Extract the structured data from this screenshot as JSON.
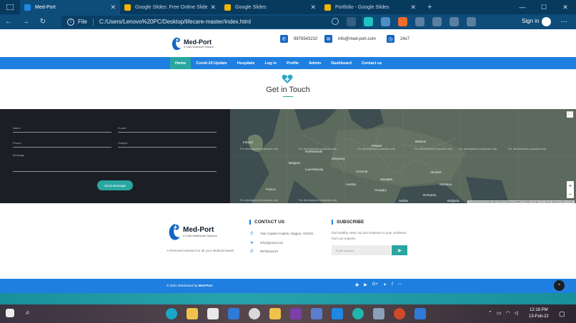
{
  "browser": {
    "tabs": [
      {
        "title": "Med-Port",
        "active": true,
        "color": "#1e88e5"
      },
      {
        "title": "Google Slides: Free Online Slide",
        "active": false,
        "color": "#f4b400"
      },
      {
        "title": "Google Slides",
        "active": false,
        "color": "#f4b400"
      },
      {
        "title": "Portfolio - Google Slides",
        "active": false,
        "color": "#f4b400"
      }
    ],
    "file_label": "File",
    "url": "C:/Users/Lenovo%20PC/Desktop/lifecare-master/index.html",
    "sign_in": "Sign in",
    "new_tab": "+"
  },
  "header": {
    "brand": "Med-Port",
    "tagline": "A Total Healthcare Solution",
    "phone": "9876543210",
    "email": "info@med-port.com",
    "hours": "24x7"
  },
  "nav": {
    "items": [
      "Home",
      "Covid-19 Update",
      "Hospitals",
      "Log in",
      "Profile",
      "Admin",
      "Dashboard",
      "Contact us"
    ],
    "active": "Home"
  },
  "contact": {
    "title": "Get in Touch",
    "form": {
      "name_placeholder": "Name",
      "email_placeholder": "E-mail",
      "phone_placeholder": "Phone",
      "subject_placeholder": "Subject",
      "message_placeholder": "Message",
      "send_label": "Send Message"
    }
  },
  "map": {
    "labels": [
      "Ireland",
      "Netherlands",
      "Poland",
      "Belarus",
      "Germany",
      "Belgium",
      "Luxembourg",
      "Czechia",
      "Ukraine",
      "Slovakia",
      "Austria",
      "Hungary",
      "Moldova",
      "Romania",
      "France",
      "Serbia",
      "Bulgaria"
    ],
    "watermark": "For development purposes only",
    "attribution": "Keyboard shortcuts  Map data ©2022 GeoBasis-DE/BKG (©2009), Google, Inst. Geogr. Nacional  Terms of Use",
    "zoom_in": "+",
    "zoom_out": "−"
  },
  "footer": {
    "brand": "Med-Port",
    "tagline": "A Total Healthcare Solution",
    "description": "A Personal Assistant for all your Medical Needs",
    "contact_heading": "CONTACT US",
    "address": "Tata Capital Heights, Nagpur, 440401",
    "email": "info@gmail.com",
    "phone": "9876543210",
    "subscribe_heading": "SUBSCRIBE",
    "subscribe_text": "Get healthy news, tip and solutions to your problems from our experts.",
    "email_placeholder": "Email address",
    "copyright_prefix": "© 2021 Distributed by",
    "copyright_brand": "Med-Port"
  },
  "taskbar": {
    "time": "12:18 PM",
    "date": "13-Feb-22"
  },
  "colors": {
    "primary": "#1f7fe0",
    "accent": "#2aa6a0",
    "dark": "#1b1f24"
  }
}
